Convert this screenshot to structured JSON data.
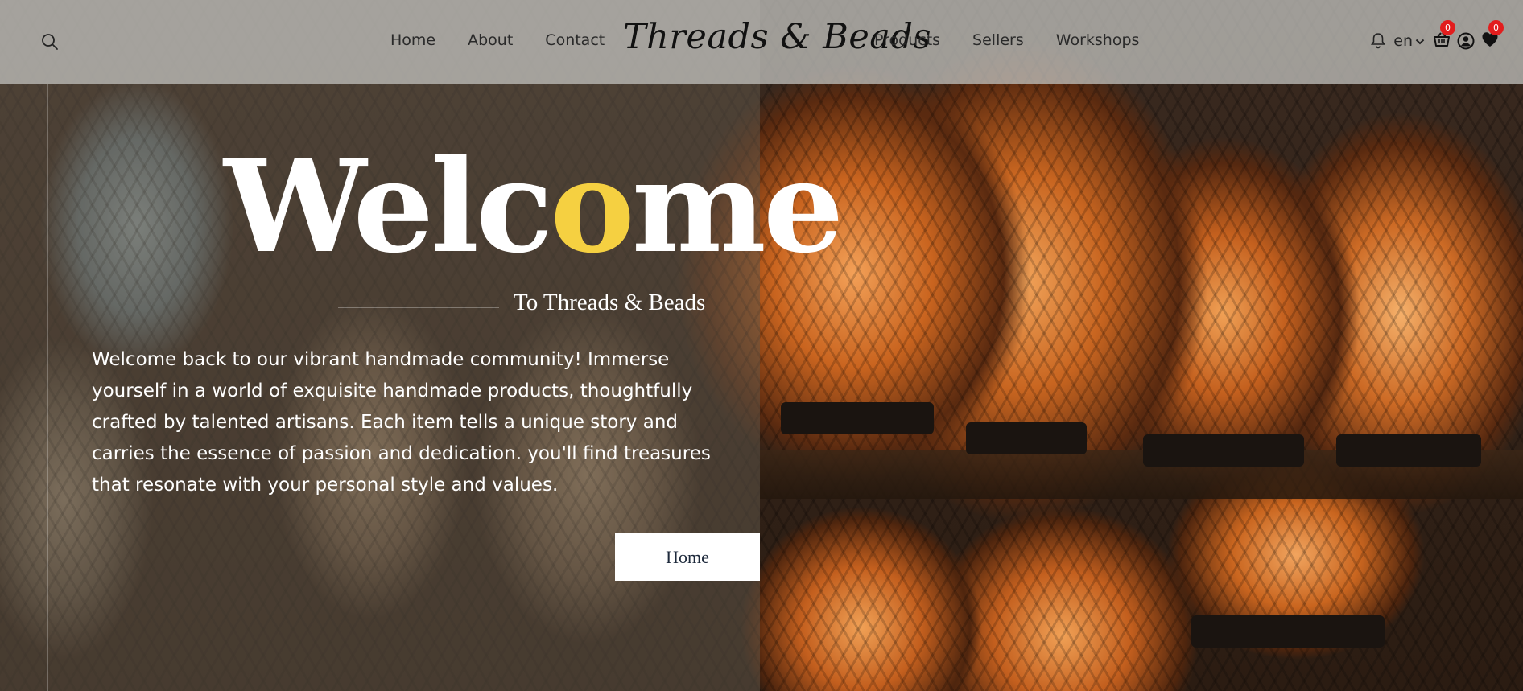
{
  "header": {
    "brand": "Threads & Beads",
    "nav_left": [
      {
        "label": "Home"
      },
      {
        "label": "About"
      },
      {
        "label": "Contact"
      }
    ],
    "nav_right": [
      {
        "label": "Products"
      },
      {
        "label": "Sellers"
      },
      {
        "label": "Workshops"
      }
    ],
    "language": "en",
    "cart_count": "0",
    "wishlist_count": "0",
    "icons": [
      "search-icon",
      "bell-icon",
      "chevron-down-icon",
      "basket-icon",
      "user-icon",
      "heart-icon"
    ]
  },
  "hero": {
    "title_pre": "Welc",
    "title_highlight": "o",
    "title_post": "me",
    "subtitle": "To Threads & Beads",
    "intro": "Welcome back to our vibrant handmade community! Immerse yourself in a world of exquisite handmade products, thoughtfully crafted by talented artisans. Each item tells a unique story and carries the essence of passion and dedication. you'll find treasures that resonate with your personal style and values.",
    "button_label": "Home"
  },
  "colors": {
    "accent": "#f5d041",
    "badge": "#e21d1d",
    "header_bg": "#bebeba"
  }
}
